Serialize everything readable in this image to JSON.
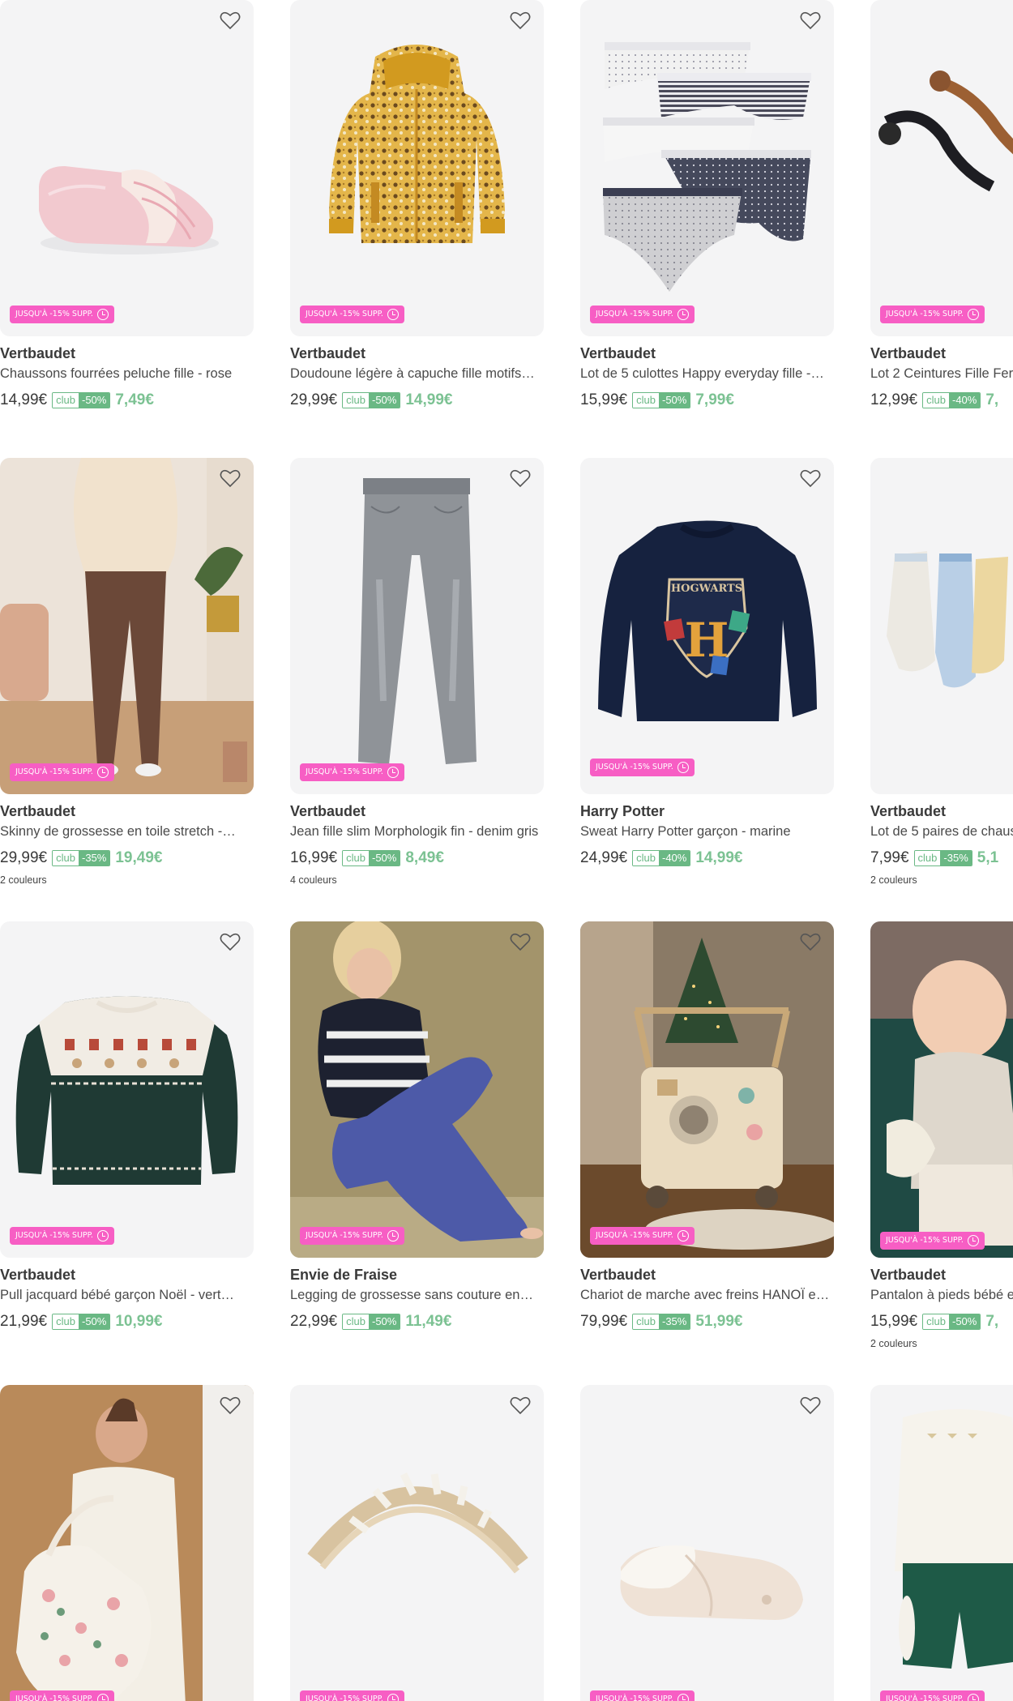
{
  "promo_label": "JUSQU'À -15% SUPP.",
  "club_label": "club",
  "products": [
    {
      "brand": "Vertbaudet",
      "name": "Chaussons fourrées peluche fille - rose",
      "old_price": "14,99€",
      "discount": "-50%",
      "new_price": "7,49€",
      "colors": "",
      "image": "pink-slippers"
    },
    {
      "brand": "Vertbaudet",
      "name": "Doudoune légère à capuche fille motifs…",
      "old_price": "29,99€",
      "discount": "-50%",
      "new_price": "14,99€",
      "colors": "",
      "image": "floral-puffer-jacket"
    },
    {
      "brand": "Vertbaudet",
      "name": "Lot de 5 culottes Happy everyday fille -…",
      "old_price": "15,99€",
      "discount": "-50%",
      "new_price": "7,99€",
      "colors": "",
      "image": "underwear-pack"
    },
    {
      "brand": "Vertbaudet",
      "name": "Lot 2 Ceintures Fille Fer",
      "old_price": "12,99€",
      "discount": "-40%",
      "new_price": "7,",
      "colors": "",
      "image": "belts"
    },
    {
      "brand": "Vertbaudet",
      "name": "Skinny de grossesse en toile stretch -…",
      "old_price": "29,99€",
      "discount": "-35%",
      "new_price": "19,49€",
      "colors": "2 couleurs",
      "image": "maternity-skinny"
    },
    {
      "brand": "Vertbaudet",
      "name": "Jean fille slim Morphologik fin - denim gris",
      "old_price": "16,99€",
      "discount": "-50%",
      "new_price": "8,49€",
      "colors": "4 couleurs",
      "image": "grey-jeans"
    },
    {
      "brand": "Harry Potter",
      "name": "Sweat Harry Potter garçon - marine",
      "old_price": "24,99€",
      "discount": "-40%",
      "new_price": "14,99€",
      "colors": "",
      "image": "hogwarts-sweatshirt"
    },
    {
      "brand": "Vertbaudet",
      "name": "Lot de 5 paires de chaus",
      "old_price": "7,99€",
      "discount": "-35%",
      "new_price": "5,1",
      "colors": "2 couleurs",
      "image": "socks"
    },
    {
      "brand": "Vertbaudet",
      "name": "Pull jacquard bébé garçon Noël - vert…",
      "old_price": "21,99€",
      "discount": "-50%",
      "new_price": "10,99€",
      "colors": "",
      "image": "christmas-sweater"
    },
    {
      "brand": "Envie de Fraise",
      "name": "Legging de grossesse sans couture en…",
      "old_price": "22,99€",
      "discount": "-50%",
      "new_price": "11,49€",
      "colors": "",
      "image": "maternity-leggings"
    },
    {
      "brand": "Vertbaudet",
      "name": "Chariot de marche avec freins HANOÏ en…",
      "old_price": "79,99€",
      "discount": "-35%",
      "new_price": "51,99€",
      "colors": "",
      "image": "baby-walker"
    },
    {
      "brand": "Vertbaudet",
      "name": "Pantalon à pieds bébé e",
      "old_price": "15,99€",
      "discount": "-50%",
      "new_price": "7,",
      "colors": "2 couleurs",
      "image": "baby-pants"
    },
    {
      "brand": "",
      "name": "",
      "old_price": "",
      "discount": "",
      "new_price": "",
      "colors": "",
      "image": "diaper-bag"
    },
    {
      "brand": "",
      "name": "",
      "old_price": "",
      "discount": "",
      "new_price": "",
      "colors": "",
      "image": "climbing-arch"
    },
    {
      "brand": "",
      "name": "",
      "old_price": "",
      "discount": "",
      "new_price": "",
      "colors": "",
      "image": "cream-slippers"
    },
    {
      "brand": "",
      "name": "",
      "old_price": "",
      "discount": "",
      "new_price": "",
      "colors": "",
      "image": "baby-outfit"
    }
  ]
}
